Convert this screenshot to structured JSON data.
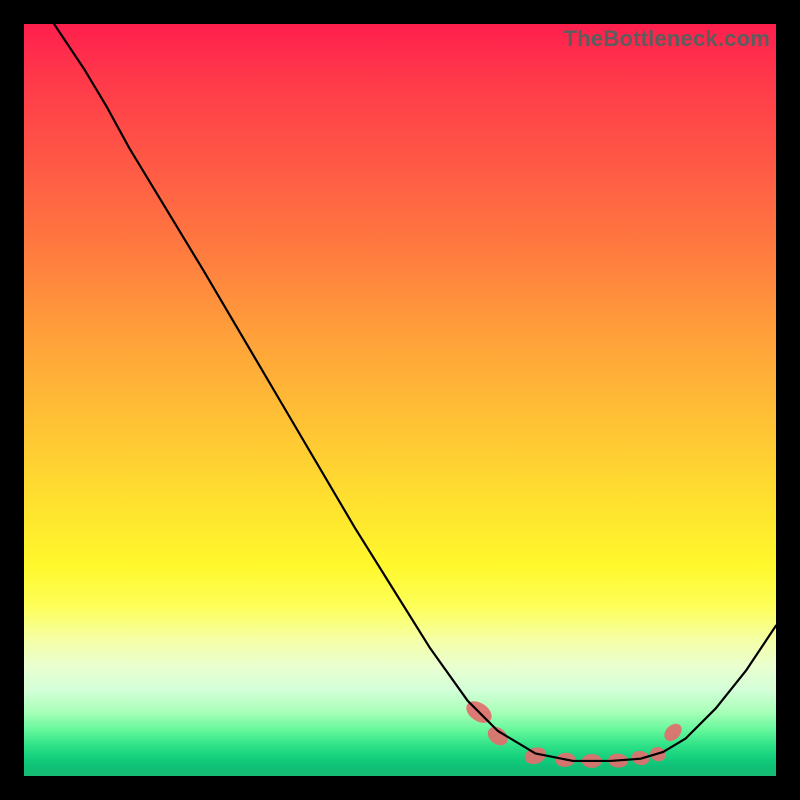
{
  "watermark": "TheBottleneck.com",
  "chart_data": {
    "type": "line",
    "title": "",
    "xlabel": "",
    "ylabel": "",
    "xlim": [
      0,
      100
    ],
    "ylim": [
      0,
      100
    ],
    "grid": false,
    "series": [
      {
        "name": "curve",
        "color": "#000000",
        "points": [
          {
            "x": 4.0,
            "y": 100.0
          },
          {
            "x": 8.0,
            "y": 94.0
          },
          {
            "x": 11.0,
            "y": 89.0
          },
          {
            "x": 14.0,
            "y": 83.5
          },
          {
            "x": 24.0,
            "y": 67.0
          },
          {
            "x": 34.0,
            "y": 50.0
          },
          {
            "x": 44.0,
            "y": 33.0
          },
          {
            "x": 54.0,
            "y": 17.0
          },
          {
            "x": 59.0,
            "y": 10.0
          },
          {
            "x": 63.0,
            "y": 6.0
          },
          {
            "x": 68.0,
            "y": 3.0
          },
          {
            "x": 73.0,
            "y": 2.0
          },
          {
            "x": 78.0,
            "y": 2.0
          },
          {
            "x": 82.0,
            "y": 2.3
          },
          {
            "x": 85.0,
            "y": 3.2
          },
          {
            "x": 88.0,
            "y": 5.0
          },
          {
            "x": 92.0,
            "y": 9.0
          },
          {
            "x": 96.0,
            "y": 14.0
          },
          {
            "x": 100.0,
            "y": 20.0
          }
        ]
      }
    ],
    "markers": [
      {
        "x": 60.5,
        "y": 8.5,
        "rx": 9,
        "ry": 14,
        "angle": -56
      },
      {
        "x": 63.0,
        "y": 5.3,
        "rx": 8,
        "ry": 11,
        "angle": -52
      },
      {
        "x": 68.0,
        "y": 2.7,
        "rx": 11,
        "ry": 8,
        "angle": -20
      },
      {
        "x": 72.0,
        "y": 2.15,
        "rx": 10,
        "ry": 7,
        "angle": -6
      },
      {
        "x": 75.5,
        "y": 2.0,
        "rx": 10,
        "ry": 7,
        "angle": 0
      },
      {
        "x": 79.0,
        "y": 2.05,
        "rx": 10,
        "ry": 7,
        "angle": 4
      },
      {
        "x": 82.0,
        "y": 2.4,
        "rx": 9,
        "ry": 7,
        "angle": 12
      },
      {
        "x": 84.3,
        "y": 2.9,
        "rx": 8,
        "ry": 7,
        "angle": 20
      },
      {
        "x": 86.3,
        "y": 5.8,
        "rx": 7,
        "ry": 10,
        "angle": 45
      }
    ],
    "marker_color": "#e26e6e"
  }
}
